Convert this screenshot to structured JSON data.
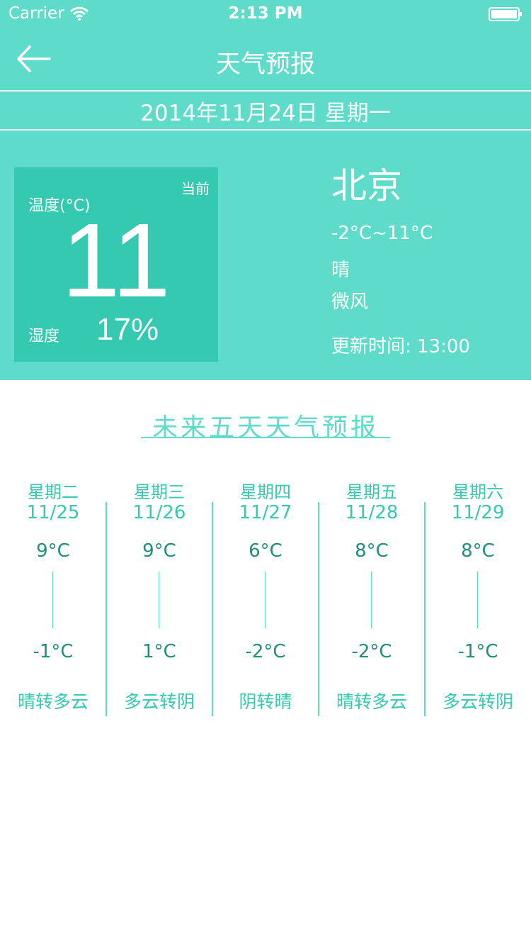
{
  "status_bar": {
    "carrier": "Carrier",
    "time": "2:13 PM",
    "wifi_icon": "wifi-icon",
    "battery_icon": "battery-icon"
  },
  "nav": {
    "title": "天气预报",
    "back_icon": "back-arrow-icon"
  },
  "date_line": "2014年11月24日 星期一",
  "current": {
    "now_label": "当前",
    "temp_label": "温度(°C)",
    "temp_value": "11",
    "humidity_label": "湿度",
    "humidity_value": "17%"
  },
  "city_info": {
    "city": "北京",
    "range": "-2°C~11°C",
    "condition": "晴",
    "wind": "微风",
    "updated": "更新时间: 13:00"
  },
  "forecast": {
    "title": "未来五天天气预报",
    "days": [
      {
        "day": "星期二",
        "date": "11/25",
        "high": "9°C",
        "low": "-1°C",
        "desc": "晴转多云"
      },
      {
        "day": "星期三",
        "date": "11/26",
        "high": "9°C",
        "low": "1°C",
        "desc": "多云转阴"
      },
      {
        "day": "星期四",
        "date": "11/27",
        "high": "6°C",
        "low": "-2°C",
        "desc": "阴转晴"
      },
      {
        "day": "星期五",
        "date": "11/28",
        "high": "8°C",
        "low": "-2°C",
        "desc": "晴转多云"
      },
      {
        "day": "星期六",
        "date": "11/29",
        "high": "8°C",
        "low": "-1°C",
        "desc": "多云转阴"
      }
    ]
  },
  "colors": {
    "accent": "#5fdcc9",
    "card": "#35c9b1",
    "text_dark": "#1f8f7c"
  }
}
